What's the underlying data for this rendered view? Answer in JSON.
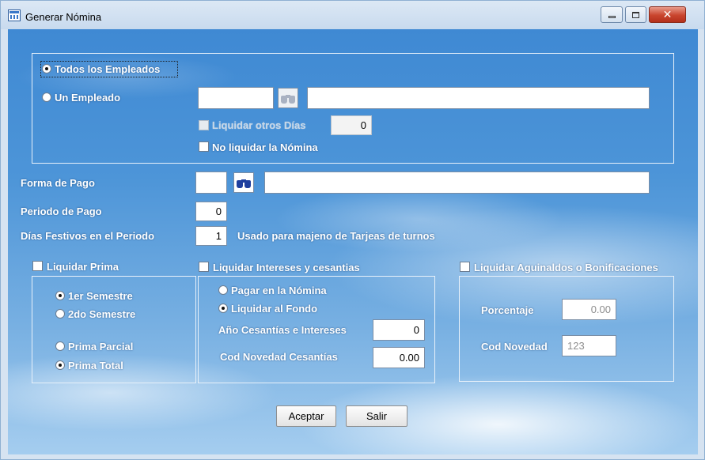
{
  "window": {
    "title": "Generar Nómina",
    "icon": "grid-window-icon",
    "controls": [
      "minimize-icon",
      "maximize-icon",
      "close-icon"
    ]
  },
  "employee_selection": {
    "all_label": "Todos los Empleados",
    "all_selected": true,
    "one_label": "Un Empleado",
    "one_selected": false,
    "employee_code": "",
    "employee_name": "",
    "liquidar_otros_dias_label": "Liquidar otros Días",
    "liquidar_otros_dias_checked": false,
    "liquidar_otros_dias_enabled": false,
    "otros_dias_value": "0",
    "no_liquidar_label": "No liquidar la Nómina",
    "no_liquidar_checked": false
  },
  "forma_pago": {
    "label": "Forma de Pago",
    "code": "",
    "description": ""
  },
  "periodo_pago": {
    "label": "Periodo de Pago",
    "value": "0"
  },
  "dias_festivos": {
    "label": "Días Festivos en el Periodo",
    "value": "1",
    "note": "Usado para majeno de Tarjeas de turnos"
  },
  "prima": {
    "label": "Liquidar Prima",
    "checked": false,
    "primer_semestre": "1er Semestre",
    "segundo_semestre": "2do Semestre",
    "semestre_selected": "1er Semestre",
    "prima_parcial": "Prima Parcial",
    "prima_total": "Prima Total",
    "tipo_selected": "Prima Total"
  },
  "intereses": {
    "label": "Liquidar Intereses y cesantias",
    "checked": false,
    "pagar_nomina": "Pagar en la Nómina",
    "liquidar_fondo": "Liquidar al Fondo",
    "selected": "Liquidar al Fondo",
    "anio_label": "Año Cesantías e Intereses",
    "anio_value": "0",
    "cod_novedad_label": "Cod Novedad Cesantías",
    "cod_novedad_value": "0.00"
  },
  "aguinaldos": {
    "label": "Liquidar Aguinaldos o Bonificaciones",
    "checked": false,
    "porcentaje_label": "Porcentaje",
    "porcentaje_value": "0.00",
    "cod_novedad_label": "Cod Novedad",
    "cod_novedad_value": "123"
  },
  "actions": {
    "aceptar": "Aceptar",
    "salir": "Salir"
  }
}
